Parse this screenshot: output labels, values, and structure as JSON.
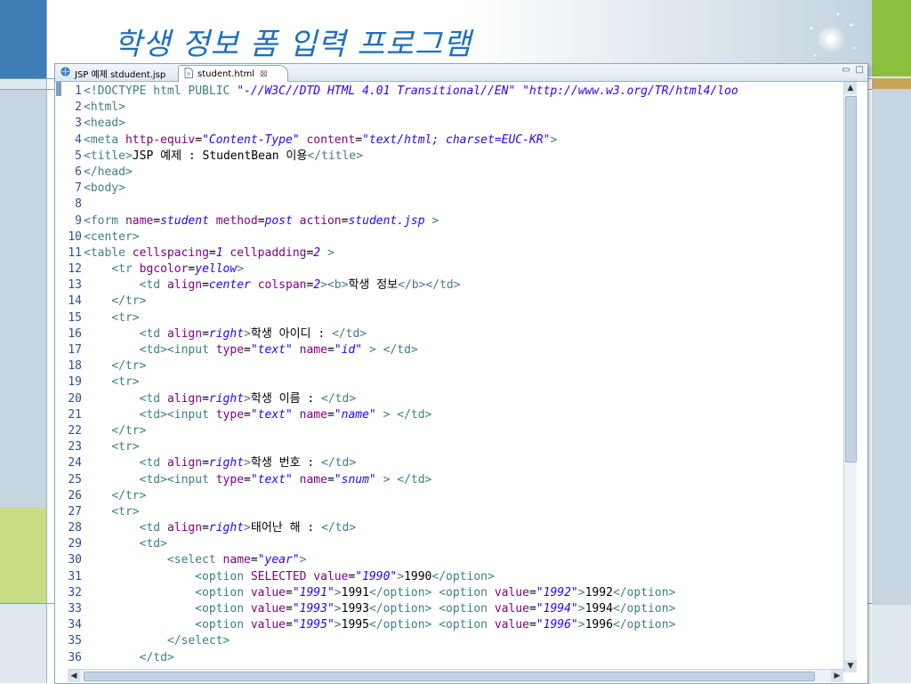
{
  "slide": {
    "title": "학생 정보 폼 입력 프로그램",
    "colors": {
      "title": "#1f6fc0",
      "left_bar": "#3d7fb6",
      "right_bar": "#8bbf3c"
    }
  },
  "editor": {
    "tabs": [
      {
        "label": "JSP 예제 stdudent.jsp",
        "icon": "jsp-globe-icon",
        "active": false
      },
      {
        "label": "student.html",
        "icon": "html-file-icon",
        "active": true,
        "close": "⊠"
      }
    ],
    "window_controls": {
      "minimize": "▭",
      "maximize": "□"
    },
    "lines": [
      {
        "n": "1",
        "segs": [
          [
            "t-tag",
            "<!DOCTYPE html "
          ],
          [
            "t-doc",
            "PUBLIC "
          ],
          [
            "t-val",
            "\"-//W3C//DTD HTML 4.01 Transitional//EN\" \"http://www.w3.org/TR/html4/loo"
          ]
        ]
      },
      {
        "n": "2",
        "segs": [
          [
            "t-tag",
            "<html>"
          ]
        ]
      },
      {
        "n": "3",
        "segs": [
          [
            "t-tag",
            "<head>"
          ]
        ]
      },
      {
        "n": "4",
        "segs": [
          [
            "t-tag",
            "<meta "
          ],
          [
            "t-attr",
            "http-equiv"
          ],
          [
            "t-text",
            "="
          ],
          [
            "t-val",
            "\"Content-Type\""
          ],
          [
            "t-text",
            " "
          ],
          [
            "t-attr",
            "content"
          ],
          [
            "t-text",
            "="
          ],
          [
            "t-val",
            "\"text/html; charset=EUC-KR\""
          ],
          [
            "t-tag",
            ">"
          ]
        ]
      },
      {
        "n": "5",
        "segs": [
          [
            "t-tag",
            "<title>"
          ],
          [
            "t-text",
            "JSP 예제 : StudentBean 이용"
          ],
          [
            "t-tag",
            "</title>"
          ]
        ]
      },
      {
        "n": "6",
        "segs": [
          [
            "t-tag",
            "</head>"
          ]
        ]
      },
      {
        "n": "7",
        "segs": [
          [
            "t-tag",
            "<body>"
          ]
        ]
      },
      {
        "n": "8",
        "segs": []
      },
      {
        "n": "9",
        "segs": [
          [
            "t-tag",
            "<form "
          ],
          [
            "t-attr",
            "name"
          ],
          [
            "t-text",
            "="
          ],
          [
            "t-val",
            "student"
          ],
          [
            "t-text",
            " "
          ],
          [
            "t-attr",
            "method"
          ],
          [
            "t-text",
            "="
          ],
          [
            "t-val",
            "post"
          ],
          [
            "t-text",
            " "
          ],
          [
            "t-attr",
            "action"
          ],
          [
            "t-text",
            "="
          ],
          [
            "t-val",
            "student.jsp"
          ],
          [
            "t-tag",
            " >"
          ]
        ]
      },
      {
        "n": "10",
        "segs": [
          [
            "t-tag",
            "<center>"
          ]
        ]
      },
      {
        "n": "11",
        "segs": [
          [
            "t-tag",
            "<table "
          ],
          [
            "t-attr",
            "cellspacing"
          ],
          [
            "t-text",
            "="
          ],
          [
            "t-val",
            "1"
          ],
          [
            "t-text",
            " "
          ],
          [
            "t-attr",
            "cellpadding"
          ],
          [
            "t-text",
            "="
          ],
          [
            "t-val",
            "2"
          ],
          [
            "t-tag",
            " >"
          ]
        ]
      },
      {
        "n": "12",
        "segs": [
          [
            "t-text",
            "    "
          ],
          [
            "t-tag",
            "<tr "
          ],
          [
            "t-attr",
            "bgcolor"
          ],
          [
            "t-text",
            "="
          ],
          [
            "t-val",
            "yellow"
          ],
          [
            "t-tag",
            ">"
          ]
        ]
      },
      {
        "n": "13",
        "segs": [
          [
            "t-text",
            "        "
          ],
          [
            "t-tag",
            "<td "
          ],
          [
            "t-attr",
            "align"
          ],
          [
            "t-text",
            "="
          ],
          [
            "t-val",
            "center"
          ],
          [
            "t-text",
            " "
          ],
          [
            "t-attr",
            "colspan"
          ],
          [
            "t-text",
            "="
          ],
          [
            "t-val",
            "2"
          ],
          [
            "t-tag",
            "><b>"
          ],
          [
            "t-text",
            "학생 정보"
          ],
          [
            "t-tag",
            "</b></td>"
          ]
        ]
      },
      {
        "n": "14",
        "segs": [
          [
            "t-text",
            "    "
          ],
          [
            "t-tag",
            "</tr>"
          ]
        ]
      },
      {
        "n": "15",
        "segs": [
          [
            "t-text",
            "    "
          ],
          [
            "t-tag",
            "<tr>"
          ]
        ]
      },
      {
        "n": "16",
        "segs": [
          [
            "t-text",
            "        "
          ],
          [
            "t-tag",
            "<td "
          ],
          [
            "t-attr",
            "align"
          ],
          [
            "t-text",
            "="
          ],
          [
            "t-val",
            "right"
          ],
          [
            "t-tag",
            ">"
          ],
          [
            "t-text",
            "학생 아이디 : "
          ],
          [
            "t-tag",
            "</td>"
          ]
        ]
      },
      {
        "n": "17",
        "segs": [
          [
            "t-text",
            "        "
          ],
          [
            "t-tag",
            "<td><input "
          ],
          [
            "t-attr",
            "type"
          ],
          [
            "t-text",
            "="
          ],
          [
            "t-val",
            "\"text\""
          ],
          [
            "t-text",
            " "
          ],
          [
            "t-attr",
            "name"
          ],
          [
            "t-text",
            "="
          ],
          [
            "t-val",
            "\"id\""
          ],
          [
            "t-tag",
            " > </td>"
          ]
        ]
      },
      {
        "n": "18",
        "segs": [
          [
            "t-text",
            "    "
          ],
          [
            "t-tag",
            "</tr>"
          ]
        ]
      },
      {
        "n": "19",
        "segs": [
          [
            "t-text",
            "    "
          ],
          [
            "t-tag",
            "<tr>"
          ]
        ]
      },
      {
        "n": "20",
        "segs": [
          [
            "t-text",
            "        "
          ],
          [
            "t-tag",
            "<td "
          ],
          [
            "t-attr",
            "align"
          ],
          [
            "t-text",
            "="
          ],
          [
            "t-val",
            "right"
          ],
          [
            "t-tag",
            ">"
          ],
          [
            "t-text",
            "학생 이름 : "
          ],
          [
            "t-tag",
            "</td>"
          ]
        ]
      },
      {
        "n": "21",
        "segs": [
          [
            "t-text",
            "        "
          ],
          [
            "t-tag",
            "<td><input "
          ],
          [
            "t-attr",
            "type"
          ],
          [
            "t-text",
            "="
          ],
          [
            "t-val",
            "\"text\""
          ],
          [
            "t-text",
            " "
          ],
          [
            "t-attr",
            "name"
          ],
          [
            "t-text",
            "="
          ],
          [
            "t-val",
            "\"name\""
          ],
          [
            "t-tag",
            " > </td>"
          ]
        ]
      },
      {
        "n": "22",
        "segs": [
          [
            "t-text",
            "    "
          ],
          [
            "t-tag",
            "</tr>"
          ]
        ]
      },
      {
        "n": "23",
        "segs": [
          [
            "t-text",
            "    "
          ],
          [
            "t-tag",
            "<tr>"
          ]
        ]
      },
      {
        "n": "24",
        "segs": [
          [
            "t-text",
            "        "
          ],
          [
            "t-tag",
            "<td "
          ],
          [
            "t-attr",
            "align"
          ],
          [
            "t-text",
            "="
          ],
          [
            "t-val",
            "right"
          ],
          [
            "t-tag",
            ">"
          ],
          [
            "t-text",
            "학생 번호 : "
          ],
          [
            "t-tag",
            "</td>"
          ]
        ]
      },
      {
        "n": "25",
        "segs": [
          [
            "t-text",
            "        "
          ],
          [
            "t-tag",
            "<td><input "
          ],
          [
            "t-attr",
            "type"
          ],
          [
            "t-text",
            "="
          ],
          [
            "t-val",
            "\"text\""
          ],
          [
            "t-text",
            " "
          ],
          [
            "t-attr",
            "name"
          ],
          [
            "t-text",
            "="
          ],
          [
            "t-val",
            "\"snum\""
          ],
          [
            "t-tag",
            " > </td>"
          ]
        ]
      },
      {
        "n": "26",
        "segs": [
          [
            "t-text",
            "    "
          ],
          [
            "t-tag",
            "</tr>"
          ]
        ]
      },
      {
        "n": "27",
        "segs": [
          [
            "t-text",
            "    "
          ],
          [
            "t-tag",
            "<tr>"
          ]
        ]
      },
      {
        "n": "28",
        "segs": [
          [
            "t-text",
            "        "
          ],
          [
            "t-tag",
            "<td "
          ],
          [
            "t-attr",
            "align"
          ],
          [
            "t-text",
            "="
          ],
          [
            "t-val",
            "right"
          ],
          [
            "t-tag",
            ">"
          ],
          [
            "t-text",
            "태어난 해 : "
          ],
          [
            "t-tag",
            "</td>"
          ]
        ]
      },
      {
        "n": "29",
        "segs": [
          [
            "t-text",
            "        "
          ],
          [
            "t-tag",
            "<td>"
          ]
        ]
      },
      {
        "n": "30",
        "segs": [
          [
            "t-text",
            "            "
          ],
          [
            "t-tag",
            "<select "
          ],
          [
            "t-attr",
            "name"
          ],
          [
            "t-text",
            "="
          ],
          [
            "t-val",
            "\"year\""
          ],
          [
            "t-tag",
            ">"
          ]
        ]
      },
      {
        "n": "31",
        "segs": [
          [
            "t-text",
            "                "
          ],
          [
            "t-tag",
            "<option "
          ],
          [
            "t-attr",
            "SELECTED value"
          ],
          [
            "t-text",
            "="
          ],
          [
            "t-val",
            "\"1990\""
          ],
          [
            "t-tag",
            ">"
          ],
          [
            "t-text",
            "1990"
          ],
          [
            "t-tag",
            "</option>"
          ]
        ]
      },
      {
        "n": "32",
        "segs": [
          [
            "t-text",
            "                "
          ],
          [
            "t-tag",
            "<option "
          ],
          [
            "t-attr",
            "value"
          ],
          [
            "t-text",
            "="
          ],
          [
            "t-val",
            "\"1991\""
          ],
          [
            "t-tag",
            ">"
          ],
          [
            "t-text",
            "1991"
          ],
          [
            "t-tag",
            "</option> <option "
          ],
          [
            "t-attr",
            "value"
          ],
          [
            "t-text",
            "="
          ],
          [
            "t-val",
            "\"1992\""
          ],
          [
            "t-tag",
            ">"
          ],
          [
            "t-text",
            "1992"
          ],
          [
            "t-tag",
            "</option>"
          ]
        ]
      },
      {
        "n": "33",
        "segs": [
          [
            "t-text",
            "                "
          ],
          [
            "t-tag",
            "<option "
          ],
          [
            "t-attr",
            "value"
          ],
          [
            "t-text",
            "="
          ],
          [
            "t-val",
            "\"1993\""
          ],
          [
            "t-tag",
            ">"
          ],
          [
            "t-text",
            "1993"
          ],
          [
            "t-tag",
            "</option> <option "
          ],
          [
            "t-attr",
            "value"
          ],
          [
            "t-text",
            "="
          ],
          [
            "t-val",
            "\"1994\""
          ],
          [
            "t-tag",
            ">"
          ],
          [
            "t-text",
            "1994"
          ],
          [
            "t-tag",
            "</option>"
          ]
        ]
      },
      {
        "n": "34",
        "segs": [
          [
            "t-text",
            "                "
          ],
          [
            "t-tag",
            "<option "
          ],
          [
            "t-attr",
            "value"
          ],
          [
            "t-text",
            "="
          ],
          [
            "t-val",
            "\"1995\""
          ],
          [
            "t-tag",
            ">"
          ],
          [
            "t-text",
            "1995"
          ],
          [
            "t-tag",
            "</option> <option "
          ],
          [
            "t-attr",
            "value"
          ],
          [
            "t-text",
            "="
          ],
          [
            "t-val",
            "\"1996\""
          ],
          [
            "t-tag",
            ">"
          ],
          [
            "t-text",
            "1996"
          ],
          [
            "t-tag",
            "</option>"
          ]
        ]
      },
      {
        "n": "35",
        "segs": [
          [
            "t-text",
            "            "
          ],
          [
            "t-tag",
            "</select>"
          ]
        ]
      },
      {
        "n": "36",
        "segs": [
          [
            "t-text",
            "        "
          ],
          [
            "t-tag",
            "</td>"
          ]
        ]
      }
    ],
    "scrollbar": {
      "up": "▲",
      "down": "▼",
      "left": "◀",
      "right": "▶"
    }
  }
}
